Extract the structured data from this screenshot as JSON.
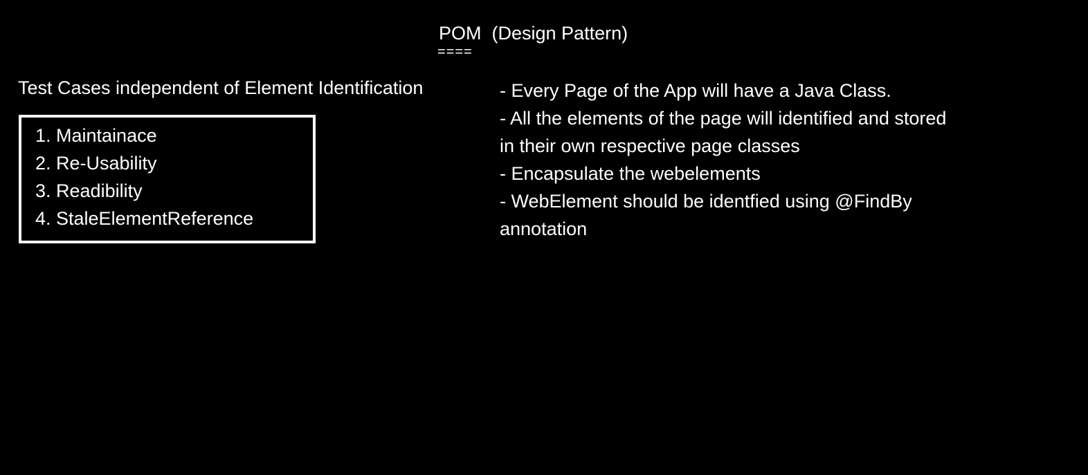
{
  "title": "POM  (Design Pattern)",
  "title_underline": "====",
  "left_heading": "Test Cases independent of Element Identification",
  "benefits": [
    "1. Maintainace",
    "2. Re-Usability",
    "3. Readibility",
    "4. StaleElementReference"
  ],
  "notes_lines": [
    "- Every Page of the App will have a Java Class.",
    "- All the elements of the page will identified and stored",
    "in their own respective page classes",
    "- Encapsulate the webelements",
    "- WebElement should be identfied using @FindBy",
    "annotation"
  ],
  "colors": {
    "background": "#000000",
    "text": "#ffffff",
    "box_border": "#ffffff"
  }
}
